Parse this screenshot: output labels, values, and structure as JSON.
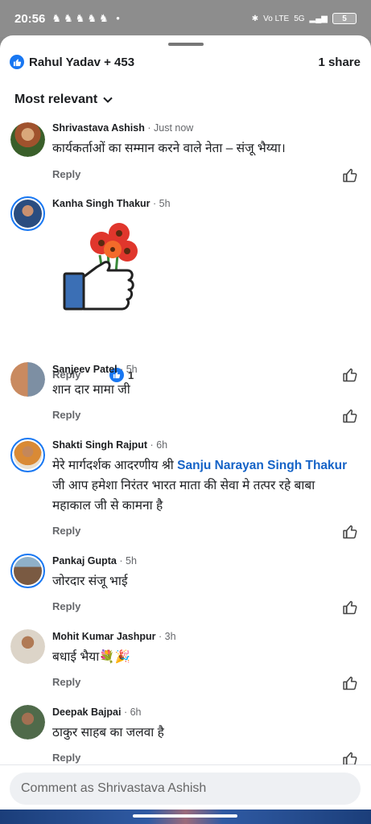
{
  "status": {
    "time": "20:56",
    "icons_left": "♞♞♞♞♞ •",
    "net": "Vo LTE",
    "signal": "5G",
    "battery": "5"
  },
  "header": {
    "reactor_label": "Rahul Yadav + 453",
    "shares_label": "1 share",
    "sort_label": "Most relevant"
  },
  "comments": [
    {
      "name": "Shrivastava Ashish",
      "time": "Just now",
      "text": "कार्यकर्ताओं का सम्मान करने वाले नेता – संजू भैय्या।",
      "reply": "Reply",
      "avatar_color": "#8a5a3c"
    },
    {
      "name": "Kanha Singh Thakur",
      "time": "5h",
      "text": "",
      "reply": "Reply",
      "reaction_count": "1",
      "avatar_color": "#3b6ea8"
    },
    {
      "name": "Sanjeev Patel",
      "time": "5h",
      "text": "शान दार मामा जी",
      "reply": "Reply",
      "avatar_color": "#9b7a5a"
    },
    {
      "name": "Shakti Singh Rajput",
      "time": "6h",
      "text_before": "मेरे मार्गदर्शक आदरणीय श्री ",
      "mention": "Sanju Narayan Singh Thakur",
      "text_after": " जी आप हमेशा निरंतर भारत माता की सेवा मे तत्पर रहे बाबा महाकाल जी से कामना है",
      "reply": "Reply",
      "avatar_color": "#c8833a"
    },
    {
      "name": "Pankaj Gupta",
      "time": "5h",
      "text": "जोरदार संजू भाई",
      "reply": "Reply",
      "avatar_color": "#7a6a5a"
    },
    {
      "name": "Mohit Kumar Jashpur",
      "time": "3h",
      "text": "बधाई भैया💐🎉",
      "reply": "Reply",
      "avatar_color": "#b5a08a"
    },
    {
      "name": "Deepak Bajpai",
      "time": "6h",
      "text": "ठाकुर साहब का जलवा है",
      "reply": "Reply",
      "avatar_color": "#4f6a4a"
    }
  ],
  "composer": {
    "placeholder": "Comment as Shrivastava Ashish"
  },
  "colors": {
    "accent": "#1877f2",
    "mention": "#1563c7",
    "meta": "#65676b"
  }
}
